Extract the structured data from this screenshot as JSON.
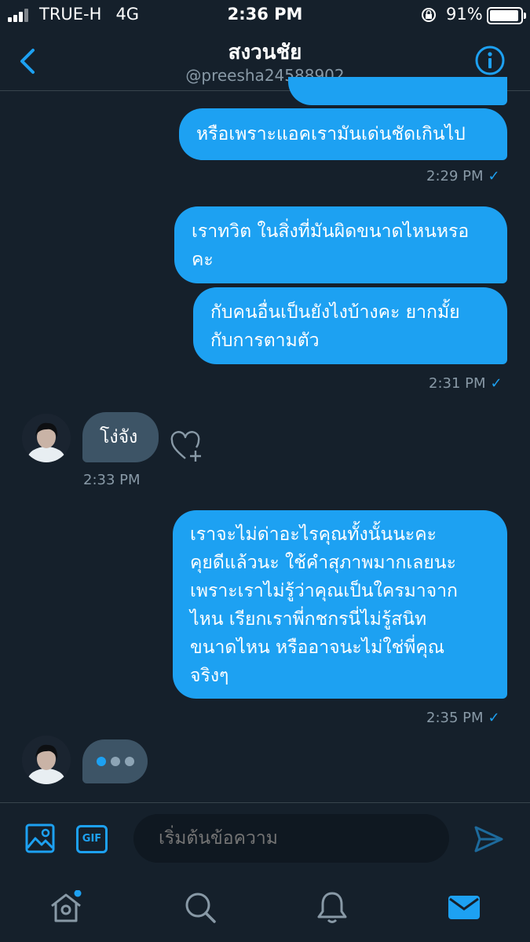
{
  "status_bar": {
    "carrier": "TRUE-H",
    "network": "4G",
    "time": "2:36 PM",
    "battery": "91%",
    "battery_level": 0.91
  },
  "header": {
    "name": "สงวนชัย",
    "handle": "@preesha24588902",
    "back_icon": "chevron-left-icon",
    "info_icon": "info-icon"
  },
  "messages": [
    {
      "id": "m1",
      "direction": "out",
      "text": "หรือเพราะแอคเรามันเด่นชัดเกินไป"
    },
    {
      "id": "m2",
      "direction": "out",
      "lines": [
        "เราทวิต ในสิ่งที่มันผิดขนาดไหนหรอ",
        "คะ"
      ]
    },
    {
      "id": "m3",
      "direction": "out",
      "lines": [
        "กับคนอื่นเป็นยังไงบ้างคะ ยากมั้ย",
        "กับการตามตัว"
      ]
    },
    {
      "id": "m4",
      "direction": "in",
      "text": "โง่จัง"
    },
    {
      "id": "m5",
      "direction": "out",
      "lines": [
        "เราจะไม่ด่าอะไรคุณทั้งนั้นนะคะ",
        "คุยดีแล้วนะ ใช้คำสุภาพมากเลยนะ",
        "เพราะเราไม่รู้ว่าคุณเป็นใครมาจาก",
        "ไหน เรียกเราพี่กชกรนี่ไม่รู้สนิท",
        "ขนาดไหน หรืออาจนะไม่ใช่พี่คุณ",
        "จริงๆ"
      ]
    }
  ],
  "timestamps": {
    "t1": "2:29 PM",
    "t2": "2:31 PM",
    "t3": "2:33 PM",
    "t4": "2:35 PM"
  },
  "compose": {
    "placeholder": "เริ่มต้นข้อความ",
    "gif_label": "GIF",
    "media_icon": "image-icon",
    "send_icon": "send-icon"
  },
  "tabs": [
    {
      "name": "home",
      "icon": "home-icon"
    },
    {
      "name": "search",
      "icon": "search-icon"
    },
    {
      "name": "notifications",
      "icon": "bell-icon"
    },
    {
      "name": "messages",
      "icon": "mail-icon",
      "active": true
    }
  ],
  "colors": {
    "background": "#15202b",
    "accent": "#1da1f2",
    "incoming_bubble": "#3d5466",
    "muted_text": "#8899a6"
  }
}
